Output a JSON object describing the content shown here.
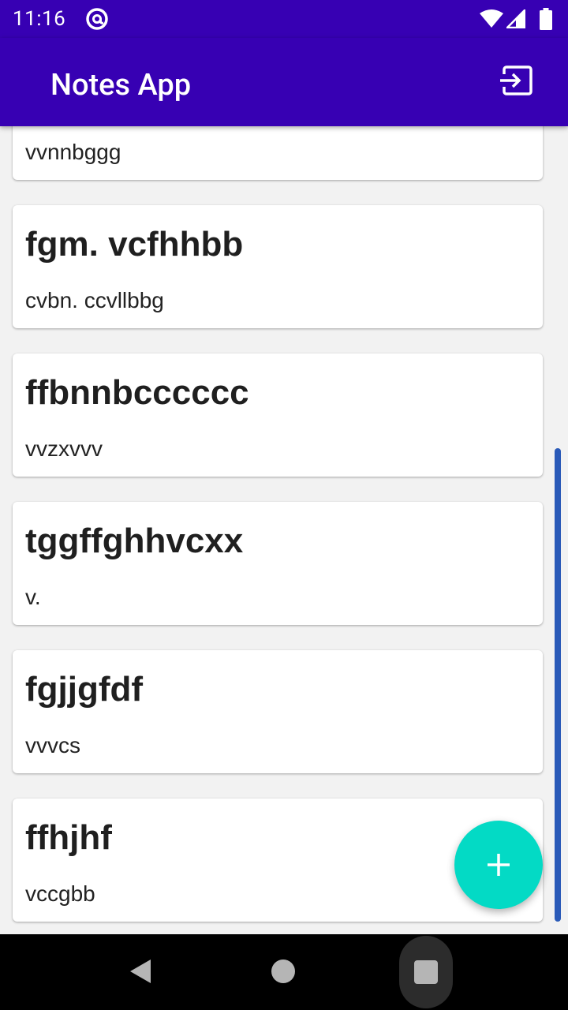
{
  "status_bar": {
    "time": "11:16",
    "icons": [
      "at-sign-icon",
      "wifi-icon",
      "cell-signal-icon",
      "battery-icon"
    ]
  },
  "app_bar": {
    "title": "Notes App",
    "actions": [
      "logout-icon"
    ]
  },
  "notes": [
    {
      "title": "",
      "body": "vvnnbggg"
    },
    {
      "title": "fgm. vcfhhbb",
      "body": "cvbn. ccvllbbg"
    },
    {
      "title": "ffbnnbcccccc",
      "body": "vvzxvvv"
    },
    {
      "title": "tggffghhvcxx",
      "body": "v."
    },
    {
      "title": "fgjjgfdf",
      "body": "vvvcs"
    },
    {
      "title": "ffhjhf",
      "body": "vccgbb"
    }
  ],
  "fab": {
    "icon": "plus-icon"
  },
  "nav_bar": {
    "icons": [
      "back-icon",
      "home-icon",
      "recents-icon"
    ]
  },
  "colors": {
    "primary": "#3700b3",
    "accent": "#03dac5",
    "scrollbar": "#2a5ab8",
    "background": "#f2f2f2"
  }
}
